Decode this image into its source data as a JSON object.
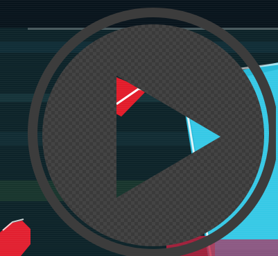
{
  "player": {
    "control_icon": "play-icon",
    "state": "paused",
    "colors": {
      "overlay_fill": "#3c3c3c",
      "ring": "#3c3c3c",
      "triangle_fill": "#ffffff",
      "bg_dark_teal": "#0e2a30",
      "bg_cyan_panel": "#2cc6e6",
      "bg_red_accent": "#e0202a",
      "bg_white": "#ffffff",
      "bg_dark_navy": "#08121c"
    }
  }
}
